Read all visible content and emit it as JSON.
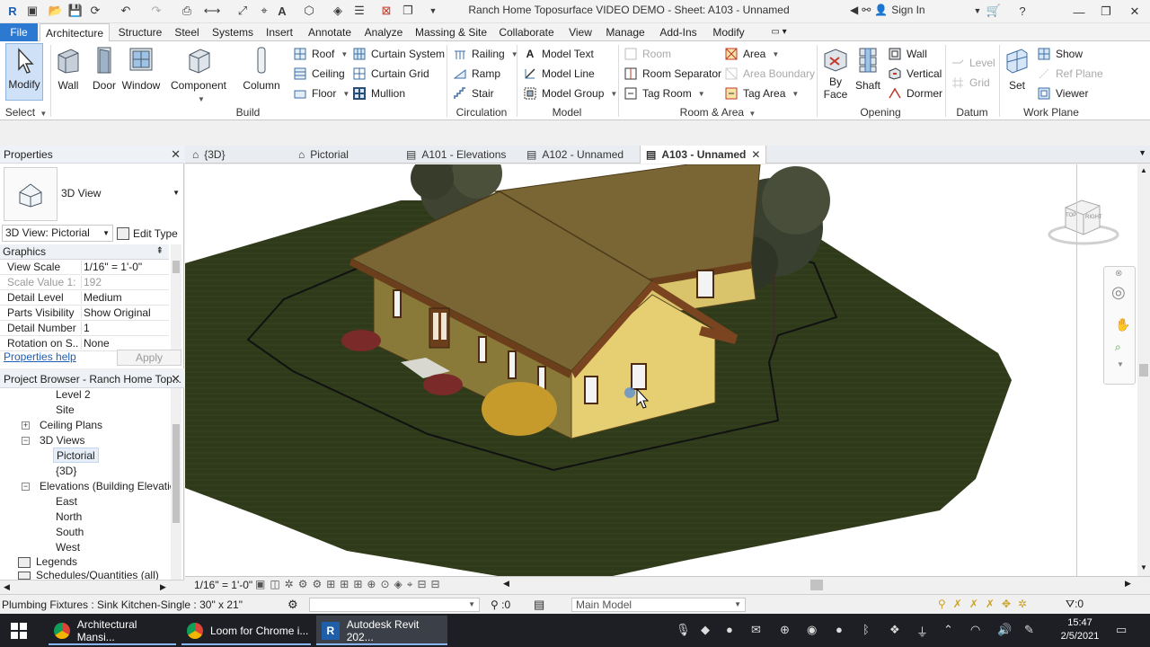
{
  "titlebar": {
    "title": "Ranch Home Toposurface VIDEO DEMO - Sheet: A103 - Unnamed",
    "sign_in": "Sign In"
  },
  "ribbon_tabs": [
    "File",
    "Architecture",
    "Structure",
    "Steel",
    "Systems",
    "Insert",
    "Annotate",
    "Analyze",
    "Massing & Site",
    "Collaborate",
    "View",
    "Manage",
    "Add-Ins",
    "Modify"
  ],
  "ribbon": {
    "select": {
      "modify": "Modify",
      "label": "Select"
    },
    "build": {
      "label": "Build",
      "wall": "Wall",
      "door": "Door",
      "window": "Window",
      "component": "Component",
      "column": "Column",
      "roof": "Roof",
      "ceiling": "Ceiling",
      "floor": "Floor",
      "curtain_system": "Curtain System",
      "curtain_grid": "Curtain Grid",
      "mullion": "Mullion"
    },
    "circulation": {
      "label": "Circulation",
      "railing": "Railing",
      "ramp": "Ramp",
      "stair": "Stair"
    },
    "model": {
      "label": "Model",
      "model_text": "Model Text",
      "model_line": "Model Line",
      "model_group": "Model Group"
    },
    "room_area": {
      "label": "Room & Area",
      "room": "Room",
      "room_separator": "Room Separator",
      "tag_room": "Tag Room",
      "area": "Area",
      "area_boundary": "Area Boundary",
      "tag_area": "Tag Area"
    },
    "opening": {
      "label": "Opening",
      "by_face": "By Face",
      "by_face_2": "Face",
      "by_face_1": "By",
      "shaft": "Shaft",
      "wall": "Wall",
      "vertical": "Vertical",
      "dormer": "Dormer"
    },
    "datum": {
      "label": "Datum",
      "level": "Level",
      "grid": "Grid"
    },
    "work_plane": {
      "label": "Work Plane",
      "set": "Set",
      "show": "Show",
      "ref_plane": "Ref Plane",
      "viewer": "Viewer"
    }
  },
  "properties": {
    "header": "Properties",
    "type_name": "3D View",
    "selector": "3D View: Pictorial",
    "edit_type": "Edit Type",
    "group": "Graphics",
    "rows": [
      {
        "k": "View Scale",
        "v": "1/16\" = 1'-0\""
      },
      {
        "k": "Scale Value    1:",
        "v": "192"
      },
      {
        "k": "Detail Level",
        "v": "Medium"
      },
      {
        "k": "Parts Visibility",
        "v": "Show Original"
      },
      {
        "k": "Detail Number",
        "v": "1"
      },
      {
        "k": "Rotation on S...",
        "v": "None"
      }
    ],
    "help": "Properties help",
    "apply": "Apply"
  },
  "browser": {
    "header": "Project Browser - Ranch Home Top...",
    "items": [
      "Level 2",
      "Site",
      "Ceiling Plans",
      "3D Views",
      "Pictorial",
      "{3D}",
      "Elevations (Building Elevation",
      "East",
      "North",
      "South",
      "West",
      "Legends",
      "Schedules/Quantities (all)"
    ]
  },
  "view_tabs": [
    "{3D}",
    "Pictorial",
    "A101 - Elevations",
    "A102 - Unnamed",
    "A103 - Unnamed"
  ],
  "view_control": {
    "scale": "1/16\" = 1'-0\""
  },
  "status": {
    "text": "Plumbing Fixtures : Sink Kitchen-Single : 30\" x 21\"",
    "zero1": ":0",
    "model": "Main Model",
    "zero2": ":0"
  },
  "taskbar": {
    "items": [
      "Architectural Mansi...",
      "Loom for Chrome i...",
      "Autodesk Revit 202..."
    ],
    "time": "15:47",
    "date": "2/5/2021"
  },
  "viewcube": {
    "top": "TOP",
    "right": "RIGHT"
  }
}
